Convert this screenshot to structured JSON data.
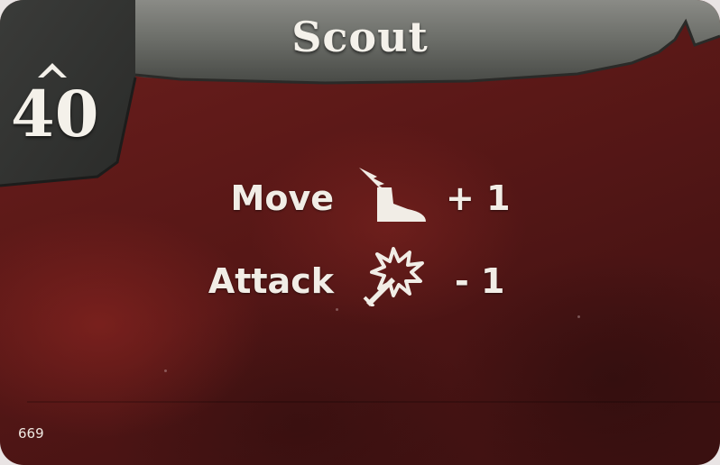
{
  "card": {
    "title": "Scout",
    "initiative": "40",
    "card_number": "669",
    "stats": [
      {
        "label": "Move",
        "icon": "winged-boot-icon",
        "value": "+ 1"
      },
      {
        "label": "Attack",
        "icon": "sword-strike-icon",
        "value": "- 1"
      }
    ]
  },
  "colors": {
    "background": "#5a1817",
    "banner": "#5e605b",
    "text": "#f4f1ea"
  }
}
